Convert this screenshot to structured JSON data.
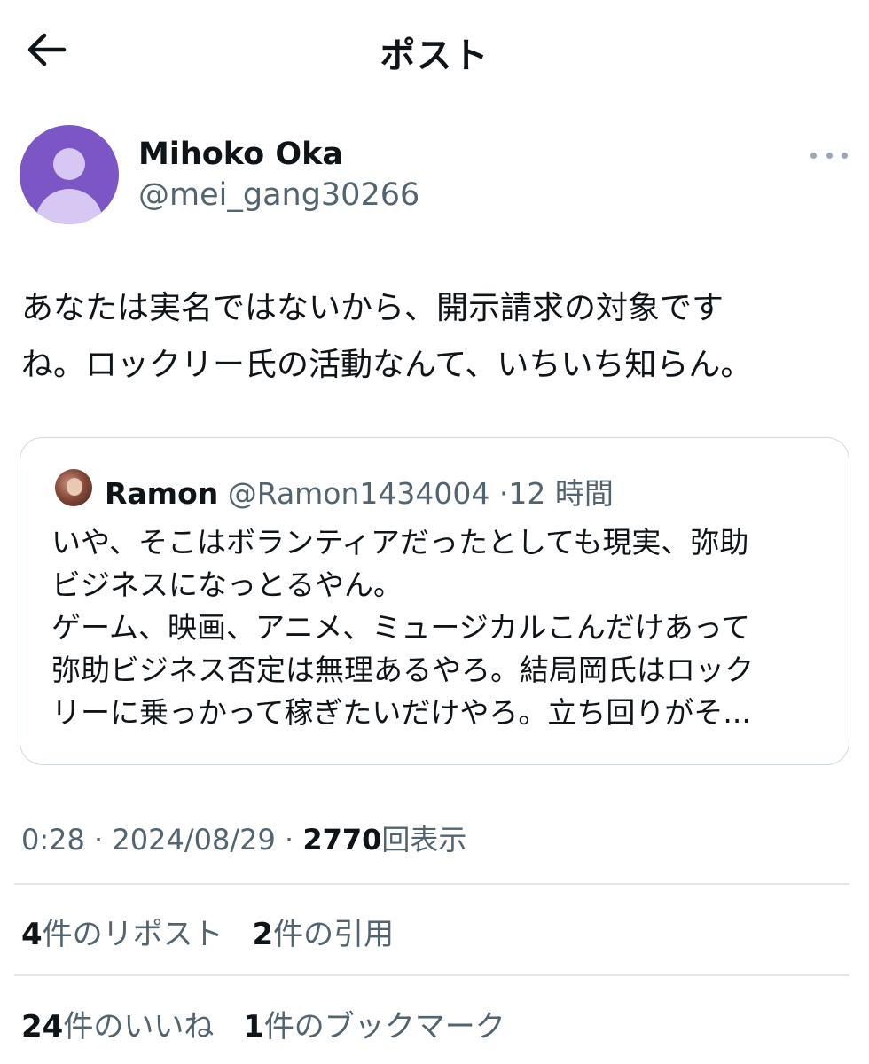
{
  "header": {
    "title": "ポスト",
    "back_icon": "arrow-left-icon"
  },
  "post": {
    "author": {
      "display_name": "Mihoko Oka",
      "handle": "@mei_gang30266",
      "avatar_color": "#7b56c4"
    },
    "text": "あなたは実名ではないから、開示請求の対象です\nね。ロックリー氏の活動なんて、いちいち知らん。",
    "quote": {
      "name": "Ramon",
      "handle": "@Ramon1434004",
      "separator": "·",
      "time": "12 時間",
      "text": "いや、そこはボランティアだったとしても現実、弥助\nビジネスになっとるやん。\nゲーム、映画、アニメ、ミュージカルこんだけあって\n弥助ビジネス否定は無理あるやろ。結局岡氏はロック\nリーに乗っかって稼ぎたいだけやろ。立ち回りがそ..."
    },
    "meta": {
      "time": "0:28",
      "date": "2024/08/29",
      "separator": "·",
      "views_count": "2770",
      "views_label": "回表示"
    },
    "stats": {
      "reposts_count": "4",
      "reposts_label": "件のリポスト",
      "quotes_count": "2",
      "quotes_label": "件の引用",
      "likes_count": "24",
      "likes_label": "件のいいね",
      "bookmarks_count": "1",
      "bookmarks_label": "件のブックマーク"
    }
  },
  "colors": {
    "text_primary": "#0f1419",
    "text_secondary": "#536471",
    "border": "#cfd9de"
  }
}
